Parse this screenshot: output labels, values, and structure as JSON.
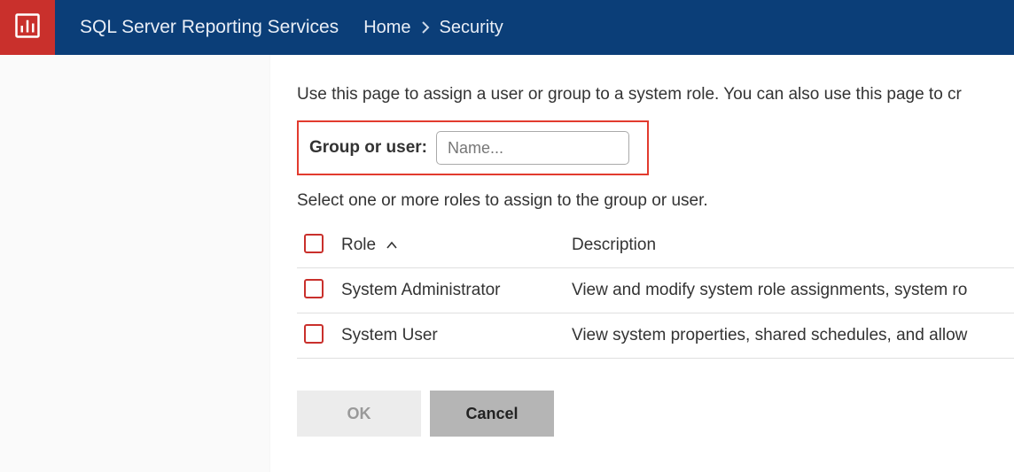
{
  "header": {
    "app_title": "SQL Server Reporting Services",
    "breadcrumb": {
      "home": "Home",
      "current": "Security"
    }
  },
  "main": {
    "intro": "Use this page to assign a user or group to a system role. You can also use this page to cr",
    "field_label": "Group or user:",
    "input_placeholder": "Name...",
    "select_text": "Select one or more roles to assign to the group or user.",
    "columns": {
      "role": "Role",
      "description": "Description"
    },
    "roles": [
      {
        "name": "System Administrator",
        "desc": "View and modify system role assignments, system ro"
      },
      {
        "name": "System User",
        "desc": "View system properties, shared schedules, and allow"
      }
    ],
    "buttons": {
      "ok": "OK",
      "cancel": "Cancel"
    }
  }
}
